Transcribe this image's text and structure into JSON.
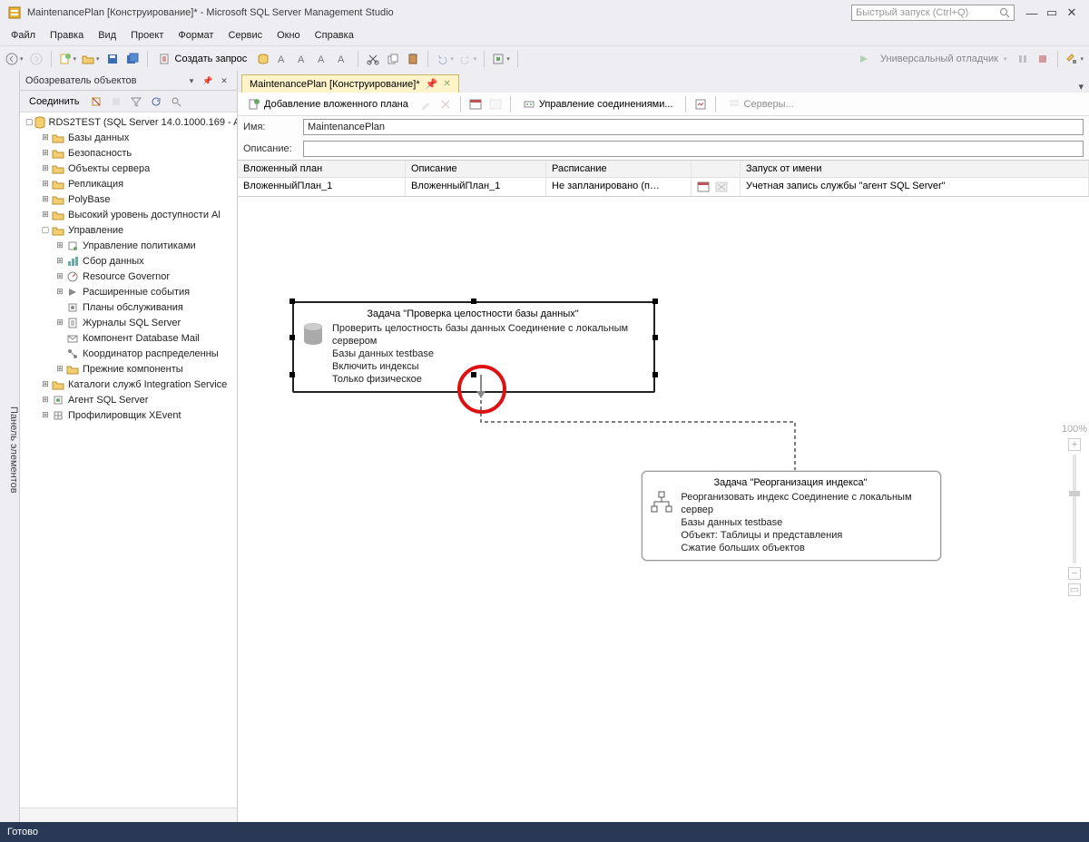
{
  "title": "MaintenancePlan [Конструирование]* - Microsoft SQL Server Management Studio",
  "quicklaunch_placeholder": "Быстрый запуск (Ctrl+Q)",
  "menu": [
    "Файл",
    "Правка",
    "Вид",
    "Проект",
    "Формат",
    "Сервис",
    "Окно",
    "Справка"
  ],
  "toolbar": {
    "newquery": "Создать запрос",
    "debugger": "Универсальный отладчик"
  },
  "sidebar_tab": "Панель элементов",
  "explorer": {
    "title": "Обозреватель объектов",
    "connect": "Соединить",
    "root": "RDS2TEST (SQL Server 14.0.1000.169 - A",
    "nodes": {
      "db": "Базы данных",
      "sec": "Безопасность",
      "srvobj": "Объекты сервера",
      "repl": "Репликация",
      "poly": "PolyBase",
      "ha": "Высокий уровень доступности Al",
      "mgmt": "Управление",
      "polmgmt": "Управление политиками",
      "datacol": "Сбор данных",
      "resgov": "Resource Governor",
      "xe": "Расширенные события",
      "maint": "Планы обслуживания",
      "logs": "Журналы SQL Server",
      "dbmail": "Компонент Database Mail",
      "dtc": "Координатор распределенны",
      "legacy": "Прежние компоненты",
      "ssis": "Каталоги служб Integration Service",
      "agent": "Агент SQL Server",
      "xep": "Профилировщик XEvent"
    }
  },
  "tab": {
    "label": "MaintenancePlan [Конструирование]*"
  },
  "doc_toolbar": {
    "addsub": "Добавление вложенного плана",
    "conn": "Управление соединениями...",
    "servers": "Серверы..."
  },
  "form": {
    "name_label": "Имя:",
    "name_value": "MaintenancePlan",
    "desc_label": "Описание:",
    "desc_value": ""
  },
  "grid": {
    "cols": [
      "Вложенный план",
      "Описание",
      "Расписание",
      "Запуск от имени"
    ],
    "row": {
      "c1": "ВложенныйПлан_1",
      "c2": "ВложенныйПлан_1",
      "c3": "Не запланировано (п…",
      "c4": "Учетная запись службы \"агент SQL Server\""
    }
  },
  "task1": {
    "title": "Задача \"Проверка целостности базы данных\"",
    "l1": "Проверить целостность базы данных Соединение с локальным сервером",
    "l2": "Базы данных testbase",
    "l3": "Включить индексы",
    "l4": "Только физическое"
  },
  "task2": {
    "title": "Задача \"Реорганизация индекса\"",
    "l1": "Реорганизовать индекс Соединение с локальным сервер",
    "l2": "Базы данных testbase",
    "l3": "Объект: Таблицы и представления",
    "l4": "Сжатие больших объектов"
  },
  "zoom": "100%",
  "status": "Готово"
}
